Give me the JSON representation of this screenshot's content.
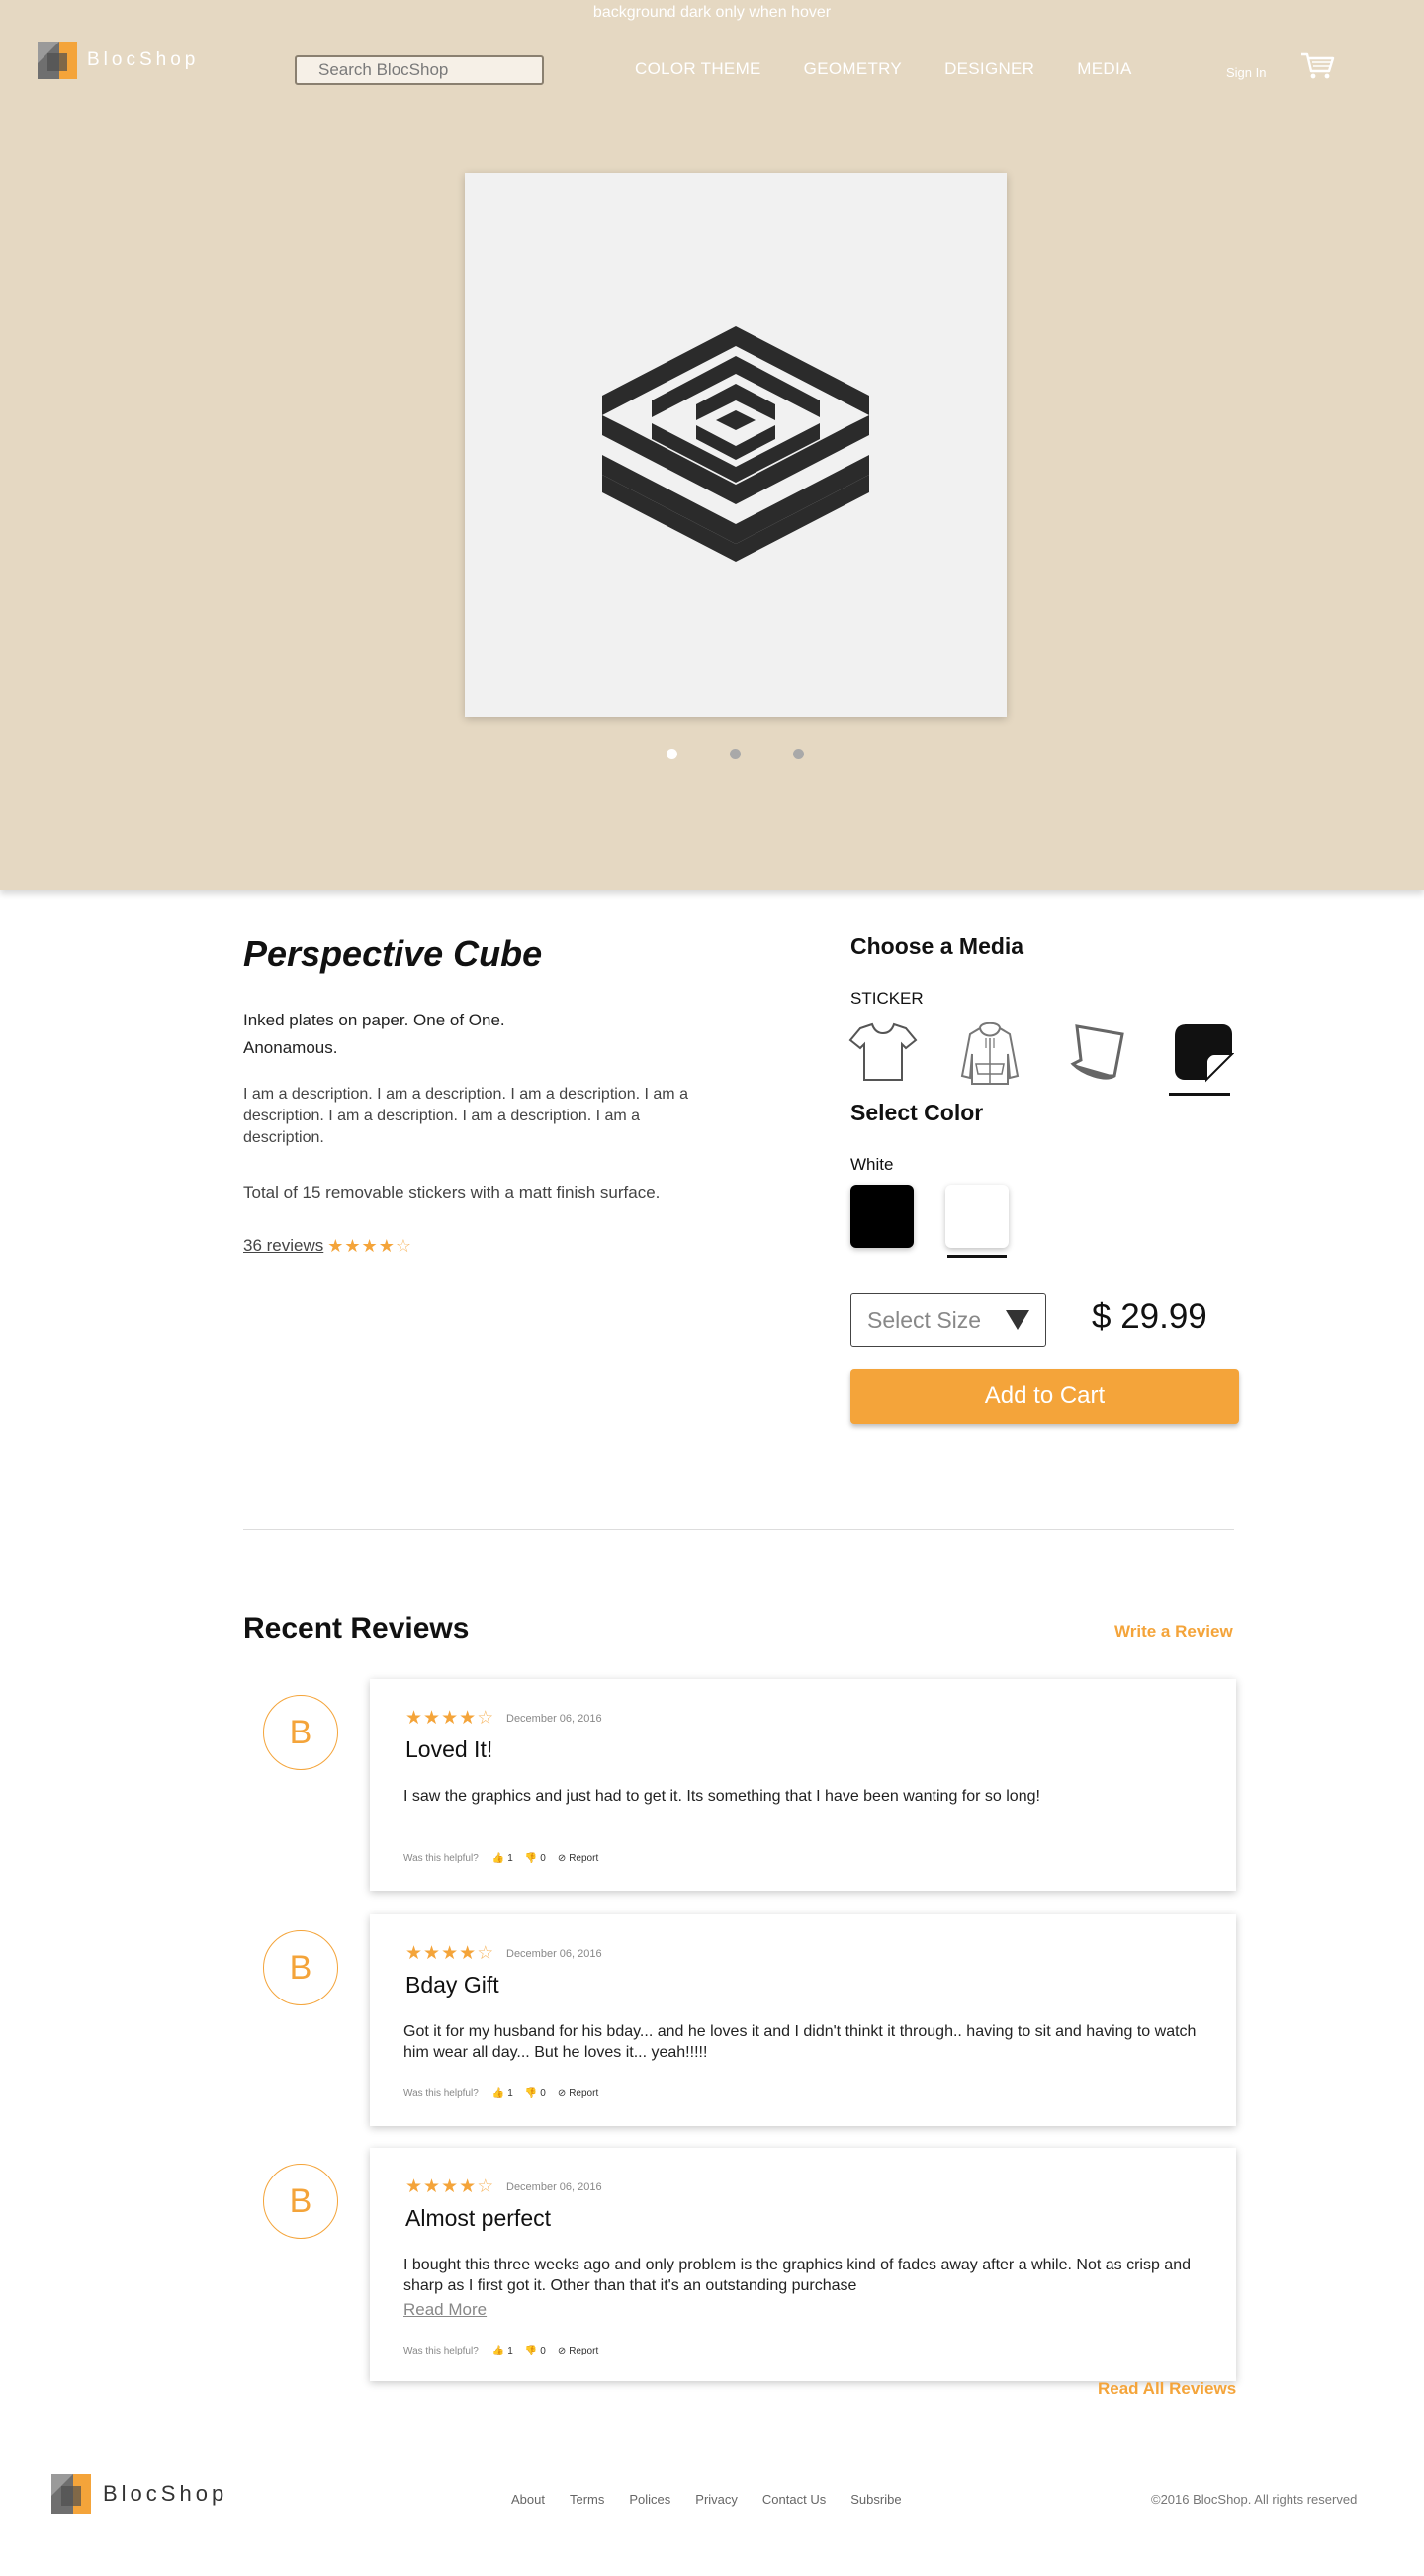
{
  "header": {
    "hover_note": "background dark only when hover",
    "logo_text": "BlocShop",
    "search_placeholder": "Search BlocShop",
    "nav": [
      "COLOR THEME",
      "GEOMETRY",
      "DESIGNER",
      "MEDIA"
    ],
    "signin": "Sign In",
    "cart_icon": "shopping-cart-icon"
  },
  "hero": {
    "carousel_dots": 3,
    "active_dot": 0
  },
  "product": {
    "title": "Perspective Cube",
    "subtitle_line1": "Inked plates on paper. One of One.",
    "subtitle_line2": "Anonamous.",
    "description": "I am a description. I am a description. I am a description. I am a description. I am a description. I am a description. I am a description.",
    "sticker_count": "Total of 15 removable stickers with a matt finish surface.",
    "reviews_link": "36 reviews",
    "rating": 4,
    "choose_media_heading": "Choose a Media",
    "selected_media": "STICKER",
    "media_options": [
      "t-shirt-icon",
      "hoodie-icon",
      "poster-icon",
      "sticker-icon"
    ],
    "select_color_heading": "Select Color",
    "selected_color": "White",
    "colors": [
      "#000000",
      "#ffffff"
    ],
    "size_placeholder": "Select Size",
    "price": "$ 29.99",
    "add_to_cart": "Add to Cart",
    "accent_color": "#f4a43a"
  },
  "reviews": {
    "heading": "Recent Reviews",
    "write_review": "Write a Review",
    "read_all": "Read All Reviews",
    "helpful_question": "Was this helpful?",
    "report_label": "Report",
    "items": [
      {
        "avatar": "B",
        "rating": 4,
        "date": "December 06, 2016",
        "title": "Loved It!",
        "body": "I saw the graphics and just had to get it. Its something that I have been wanting for so long!",
        "likes": "1",
        "dislikes": "0"
      },
      {
        "avatar": "B",
        "rating": 4,
        "date": "December 06, 2016",
        "title": "Bday Gift",
        "body": "Got it for my husband for his bday... and he loves it and I didn't thinkt it through.. having to sit and having to watch him wear all day... But he loves it... yeah!!!!!",
        "likes": "1",
        "dislikes": "0"
      },
      {
        "avatar": "B",
        "rating": 4,
        "date": "December 06, 2016",
        "title": "Almost perfect",
        "body": "I bought this three weeks ago and only problem is the graphics kind of fades away after a while. Not as crisp and sharp as I first got it. Other than that it's an outstanding  purchase",
        "read_more": "Read More",
        "likes": "1",
        "dislikes": "0"
      }
    ]
  },
  "footer": {
    "logo_text": "BlocShop",
    "links": [
      "About",
      "Terms",
      "Polices",
      "Privacy",
      "Contact Us",
      "Subsribe"
    ],
    "copyright": "©2016 BlocShop. All rights reserved"
  }
}
